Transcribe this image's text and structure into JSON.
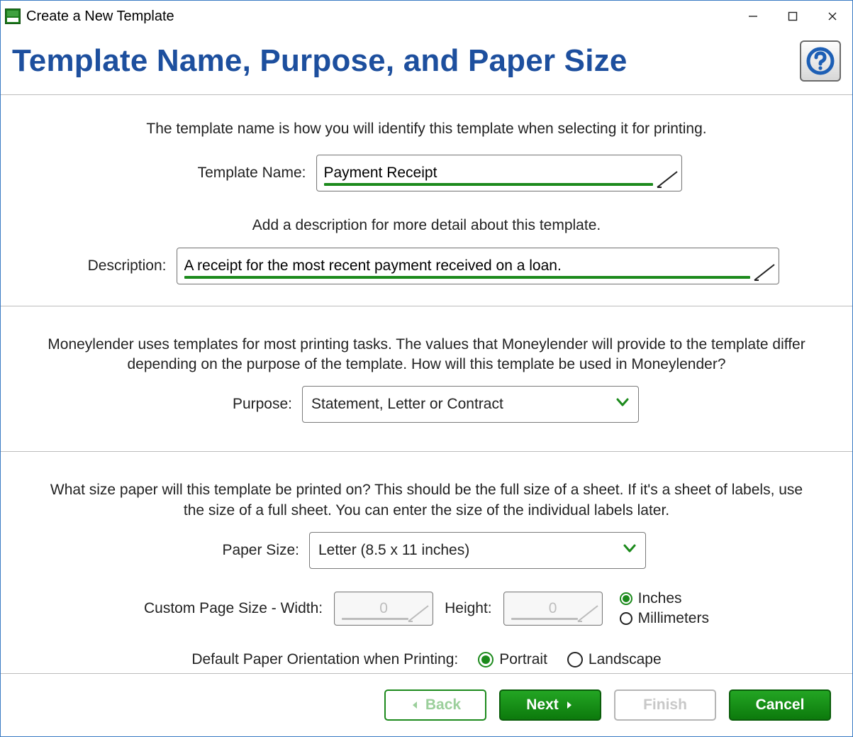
{
  "window": {
    "title": "Create a New Template"
  },
  "header": {
    "page_title": "Template Name, Purpose, and Paper Size"
  },
  "section_name": {
    "intro": "The template name is how you will identify this template when selecting it for printing.",
    "template_name_label": "Template Name:",
    "template_name_value": "Payment Receipt",
    "description_intro": "Add a description for more detail about this template.",
    "description_label": "Description:",
    "description_value": "A receipt for the most recent payment received on a loan."
  },
  "section_purpose": {
    "intro": "Moneylender uses templates for most printing tasks. The values that Moneylender will provide to the template differ depending on the purpose of the template. How will this template be used in Moneylender?",
    "purpose_label": "Purpose:",
    "purpose_value": "Statement, Letter or Contract"
  },
  "section_paper": {
    "intro": "What size paper will this template be printed on? This should be the full size of a sheet. If it's a sheet of labels, use the size of a full sheet. You can enter the size of the individual labels later.",
    "paper_size_label": "Paper Size:",
    "paper_size_value": "Letter (8.5 x 11 inches)",
    "custom_width_label": "Custom Page Size - Width:",
    "custom_width_value": "0",
    "custom_height_label": "Height:",
    "custom_height_value": "0",
    "units": {
      "inches": "Inches",
      "millimeters": "Millimeters",
      "selected": "inches"
    },
    "orientation_label": "Default Paper Orientation when Printing:",
    "orientation": {
      "portrait": "Portrait",
      "landscape": "Landscape",
      "selected": "portrait"
    }
  },
  "footer": {
    "back": "Back",
    "next": "Next",
    "finish": "Finish",
    "cancel": "Cancel"
  }
}
